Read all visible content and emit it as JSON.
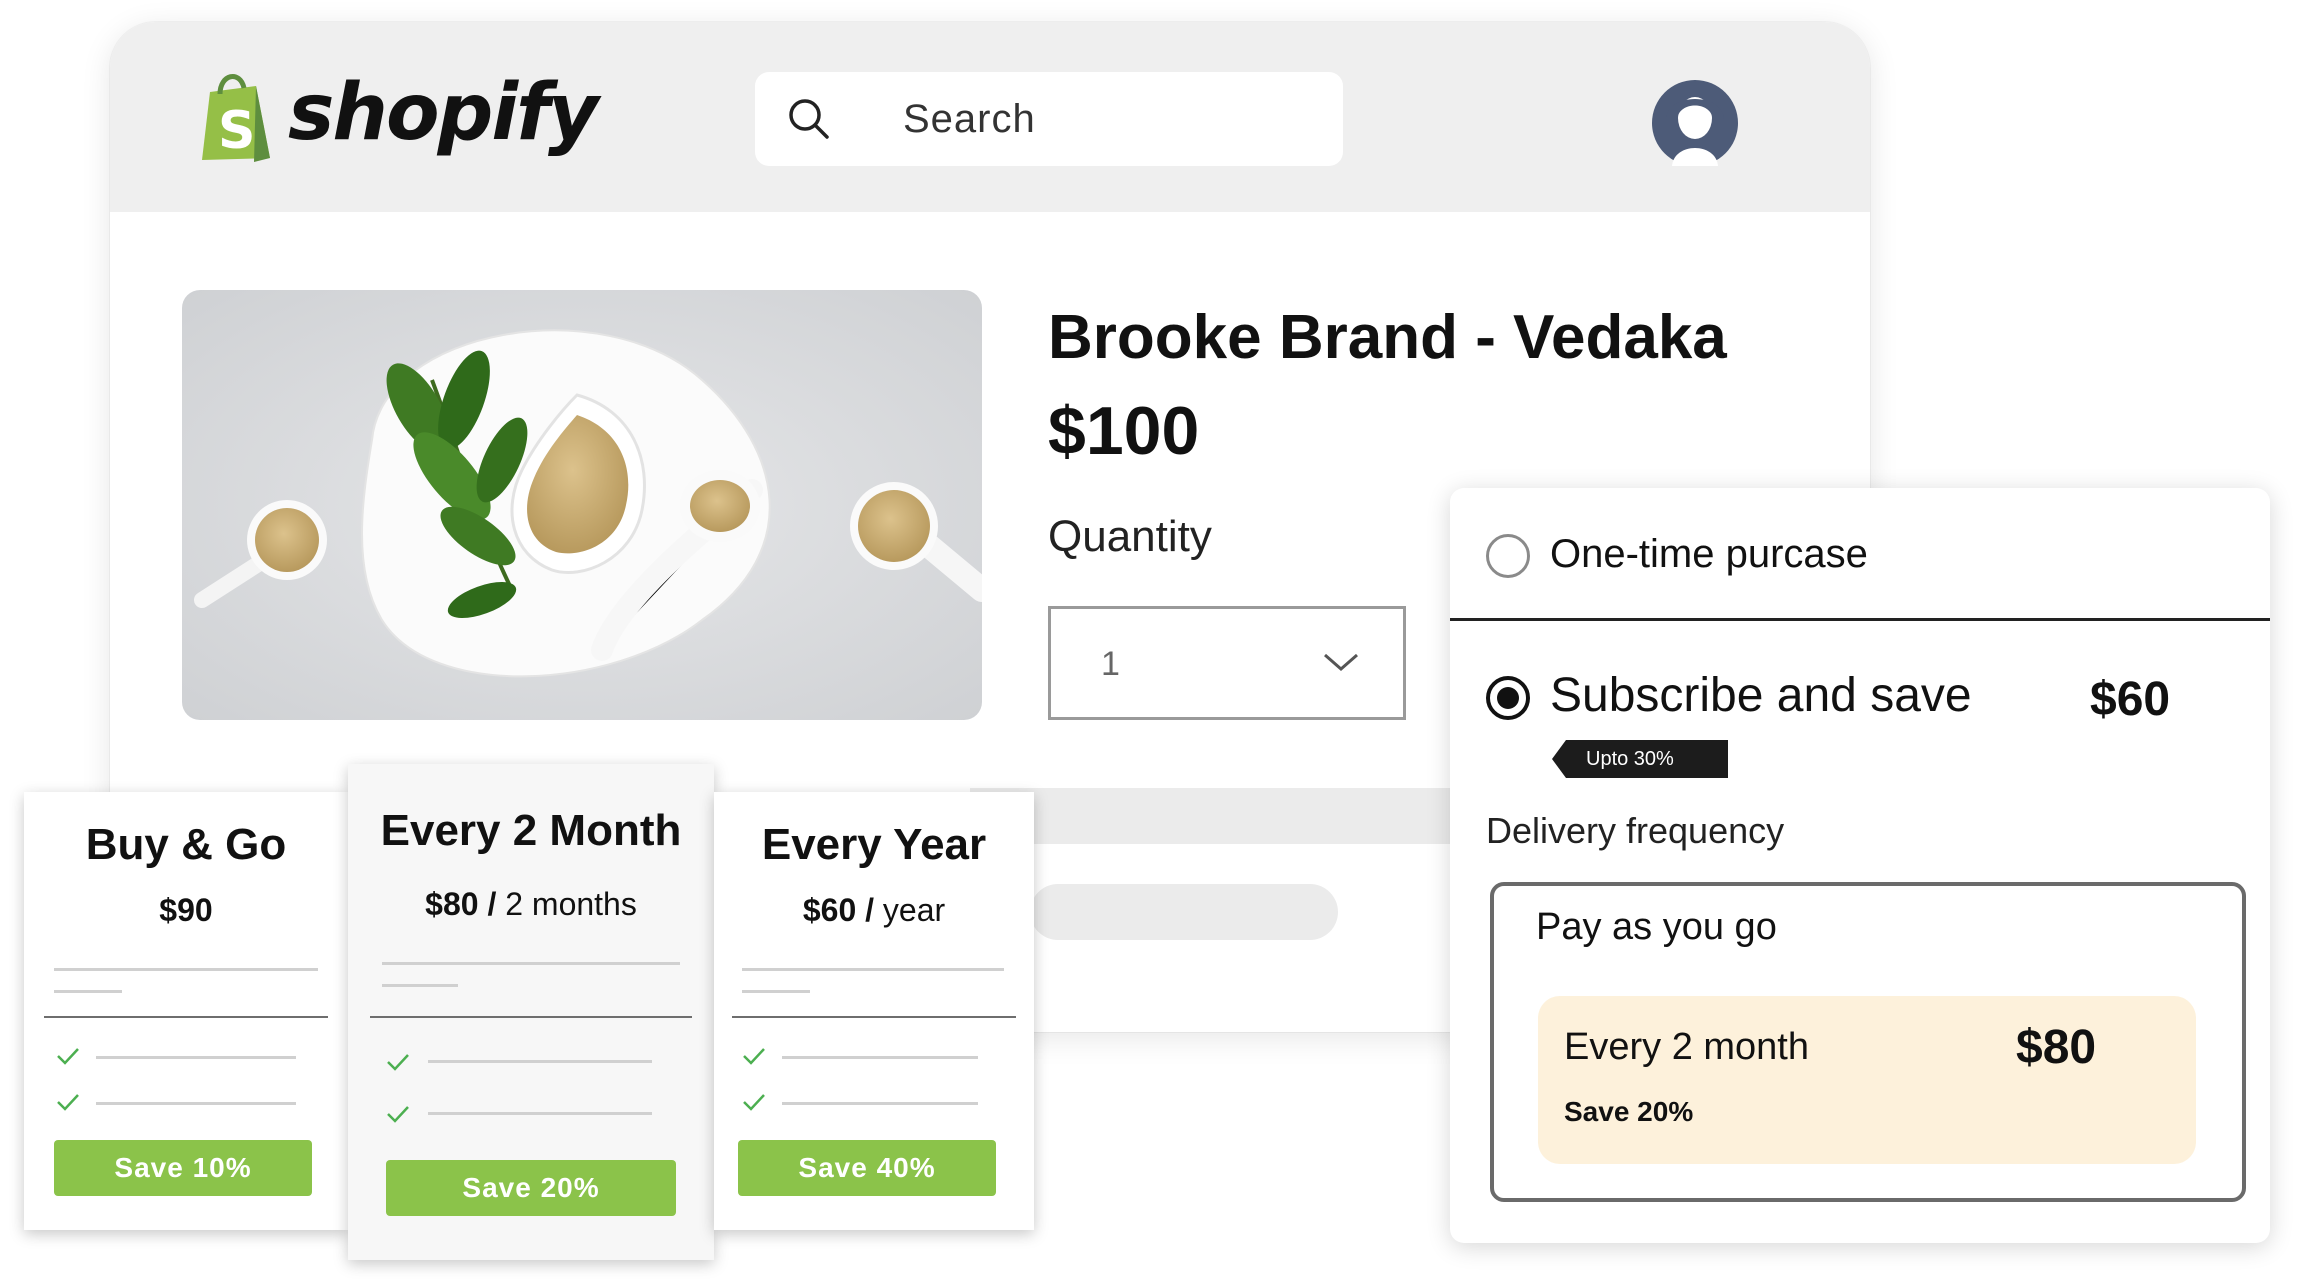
{
  "brand": {
    "name": "shopify",
    "logo_color": "#95bf47"
  },
  "search": {
    "placeholder": "Search",
    "icon": "search-icon"
  },
  "user": {
    "avatar_icon": "user-avatar-icon",
    "avatar_color": "#4d5b78"
  },
  "product": {
    "title": "Brooke Brand - Vedaka",
    "price": "$100",
    "quantity_label": "Quantity",
    "quantity_value": "1"
  },
  "plans": [
    {
      "title": "Buy & Go",
      "price": "$90",
      "period": "",
      "save": "Save 10%"
    },
    {
      "title": "Every 2 Month",
      "price": "$80 /",
      "period": "2 months",
      "save": "Save 20%"
    },
    {
      "title": "Every Year",
      "price": "$60 /",
      "period": "year",
      "save": "Save 40%"
    }
  ],
  "purchase_options": {
    "one_time": {
      "label": "One-time purcase",
      "selected": false
    },
    "subscribe": {
      "label": "Subscribe and save",
      "price": "$60",
      "badge": "Upto 30%",
      "selected": true
    },
    "delivery_frequency_label": "Delivery frequency",
    "frequency_box": {
      "title": "Pay as you go",
      "option_label": "Every 2 month",
      "option_price": "$80",
      "option_save": "Save 20%"
    }
  },
  "colors": {
    "accent_green": "#8bc34a",
    "highlight_cream": "#fdf1db",
    "header_bg": "#efefef"
  }
}
